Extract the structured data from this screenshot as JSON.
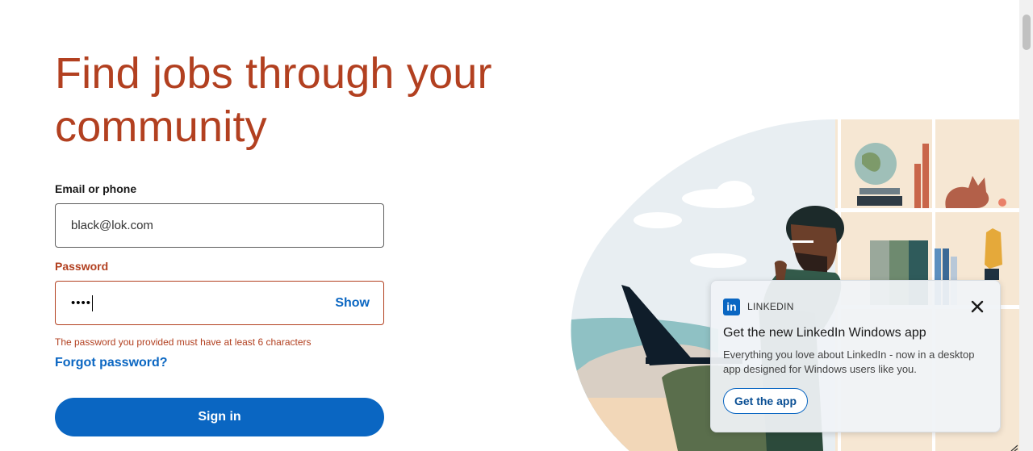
{
  "hero": {
    "title": "Find jobs through your community"
  },
  "form": {
    "email_label": "Email or phone",
    "email_value": "black@lok.com",
    "password_label": "Password",
    "password_masked": "••••",
    "show_label": "Show",
    "error_text": "The password you provided must have at least 6 characters",
    "forgot_label": "Forgot password?",
    "signin_label": "Sign in"
  },
  "toast": {
    "app_name": "LINKEDIN",
    "logo_text": "in",
    "title": "Get the new LinkedIn Windows app",
    "body": "Everything you love about LinkedIn - now in a desktop app designed for Windows users like you.",
    "button_label": "Get the app"
  },
  "colors": {
    "brand_blue": "#0a66c2",
    "error_red": "#b24020",
    "title_color": "#b24020"
  }
}
